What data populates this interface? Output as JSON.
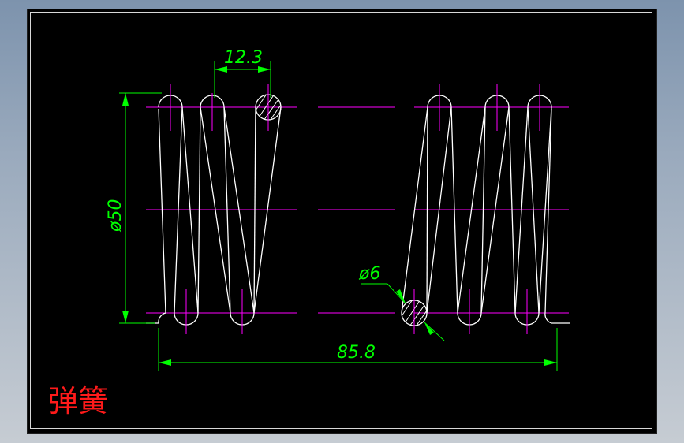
{
  "drawing": {
    "title": "弹簧",
    "colors": {
      "background": "#000000",
      "spring": "#ffffff",
      "centerline": "#ff00ff",
      "dimension": "#00ff00",
      "title": "#ff1a1a"
    },
    "dimensions": {
      "pitch": "12.3",
      "outer_diameter": "ø50",
      "wire_diameter": "ø6",
      "free_length": "85.8"
    }
  }
}
